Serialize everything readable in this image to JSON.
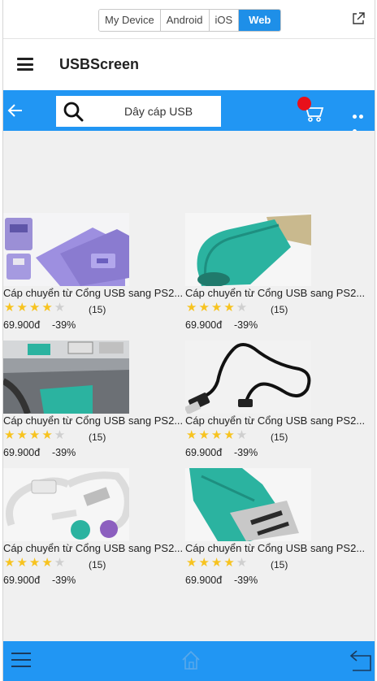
{
  "device_switcher": {
    "tabs": [
      {
        "label": "My Device"
      },
      {
        "label": "Android"
      },
      {
        "label": "iOS"
      },
      {
        "label": "Web"
      }
    ],
    "active_tab": "Web"
  },
  "app": {
    "title": "USBScreen"
  },
  "toolbar": {
    "search_text": "Dây cáp USB",
    "cart_badge_color": "#e8101a",
    "accent_color": "#2196f3"
  },
  "products": [
    {
      "name": "Cáp chuyển từ Cổng USB sang PS2...",
      "rating": 4,
      "rating_max": 5,
      "reviews": "(15)",
      "price": "69.900đ",
      "discount": "-39%",
      "image": "purple-ps2-adapter"
    },
    {
      "name": "Cáp chuyển từ Cổng USB sang PS2...",
      "rating": 4,
      "rating_max": 5,
      "reviews": "(15)",
      "price": "69.900đ",
      "discount": "-39%",
      "image": "green-usb-ps2-adapter"
    },
    {
      "name": "Cáp chuyển từ Cổng USB sang PS2...",
      "rating": 4,
      "rating_max": 5,
      "reviews": "(15)",
      "price": "69.900đ",
      "discount": "-39%",
      "image": "green-connectors-in-port"
    },
    {
      "name": "Cáp chuyển từ Cổng USB sang PS2...",
      "rating": 4,
      "rating_max": 5,
      "reviews": "(15)",
      "price": "69.900đ",
      "discount": "-39%",
      "image": "black-usb-cable"
    },
    {
      "name": "Cáp chuyển từ Cổng USB sang PS2...",
      "rating": 4,
      "rating_max": 5,
      "reviews": "(15)",
      "price": "69.900đ",
      "discount": "-39%",
      "image": "white-usb-ps2-splitter"
    },
    {
      "name": "Cáp chuyển từ Cổng USB sang PS2...",
      "rating": 4,
      "rating_max": 5,
      "reviews": "(15)",
      "price": "69.900đ",
      "discount": "-39%",
      "image": "green-usb-adapter-closeup"
    }
  ],
  "bottom_nav": {
    "items": [
      {
        "icon": "menu-icon"
      },
      {
        "icon": "home-icon"
      },
      {
        "icon": "back-icon"
      }
    ]
  }
}
